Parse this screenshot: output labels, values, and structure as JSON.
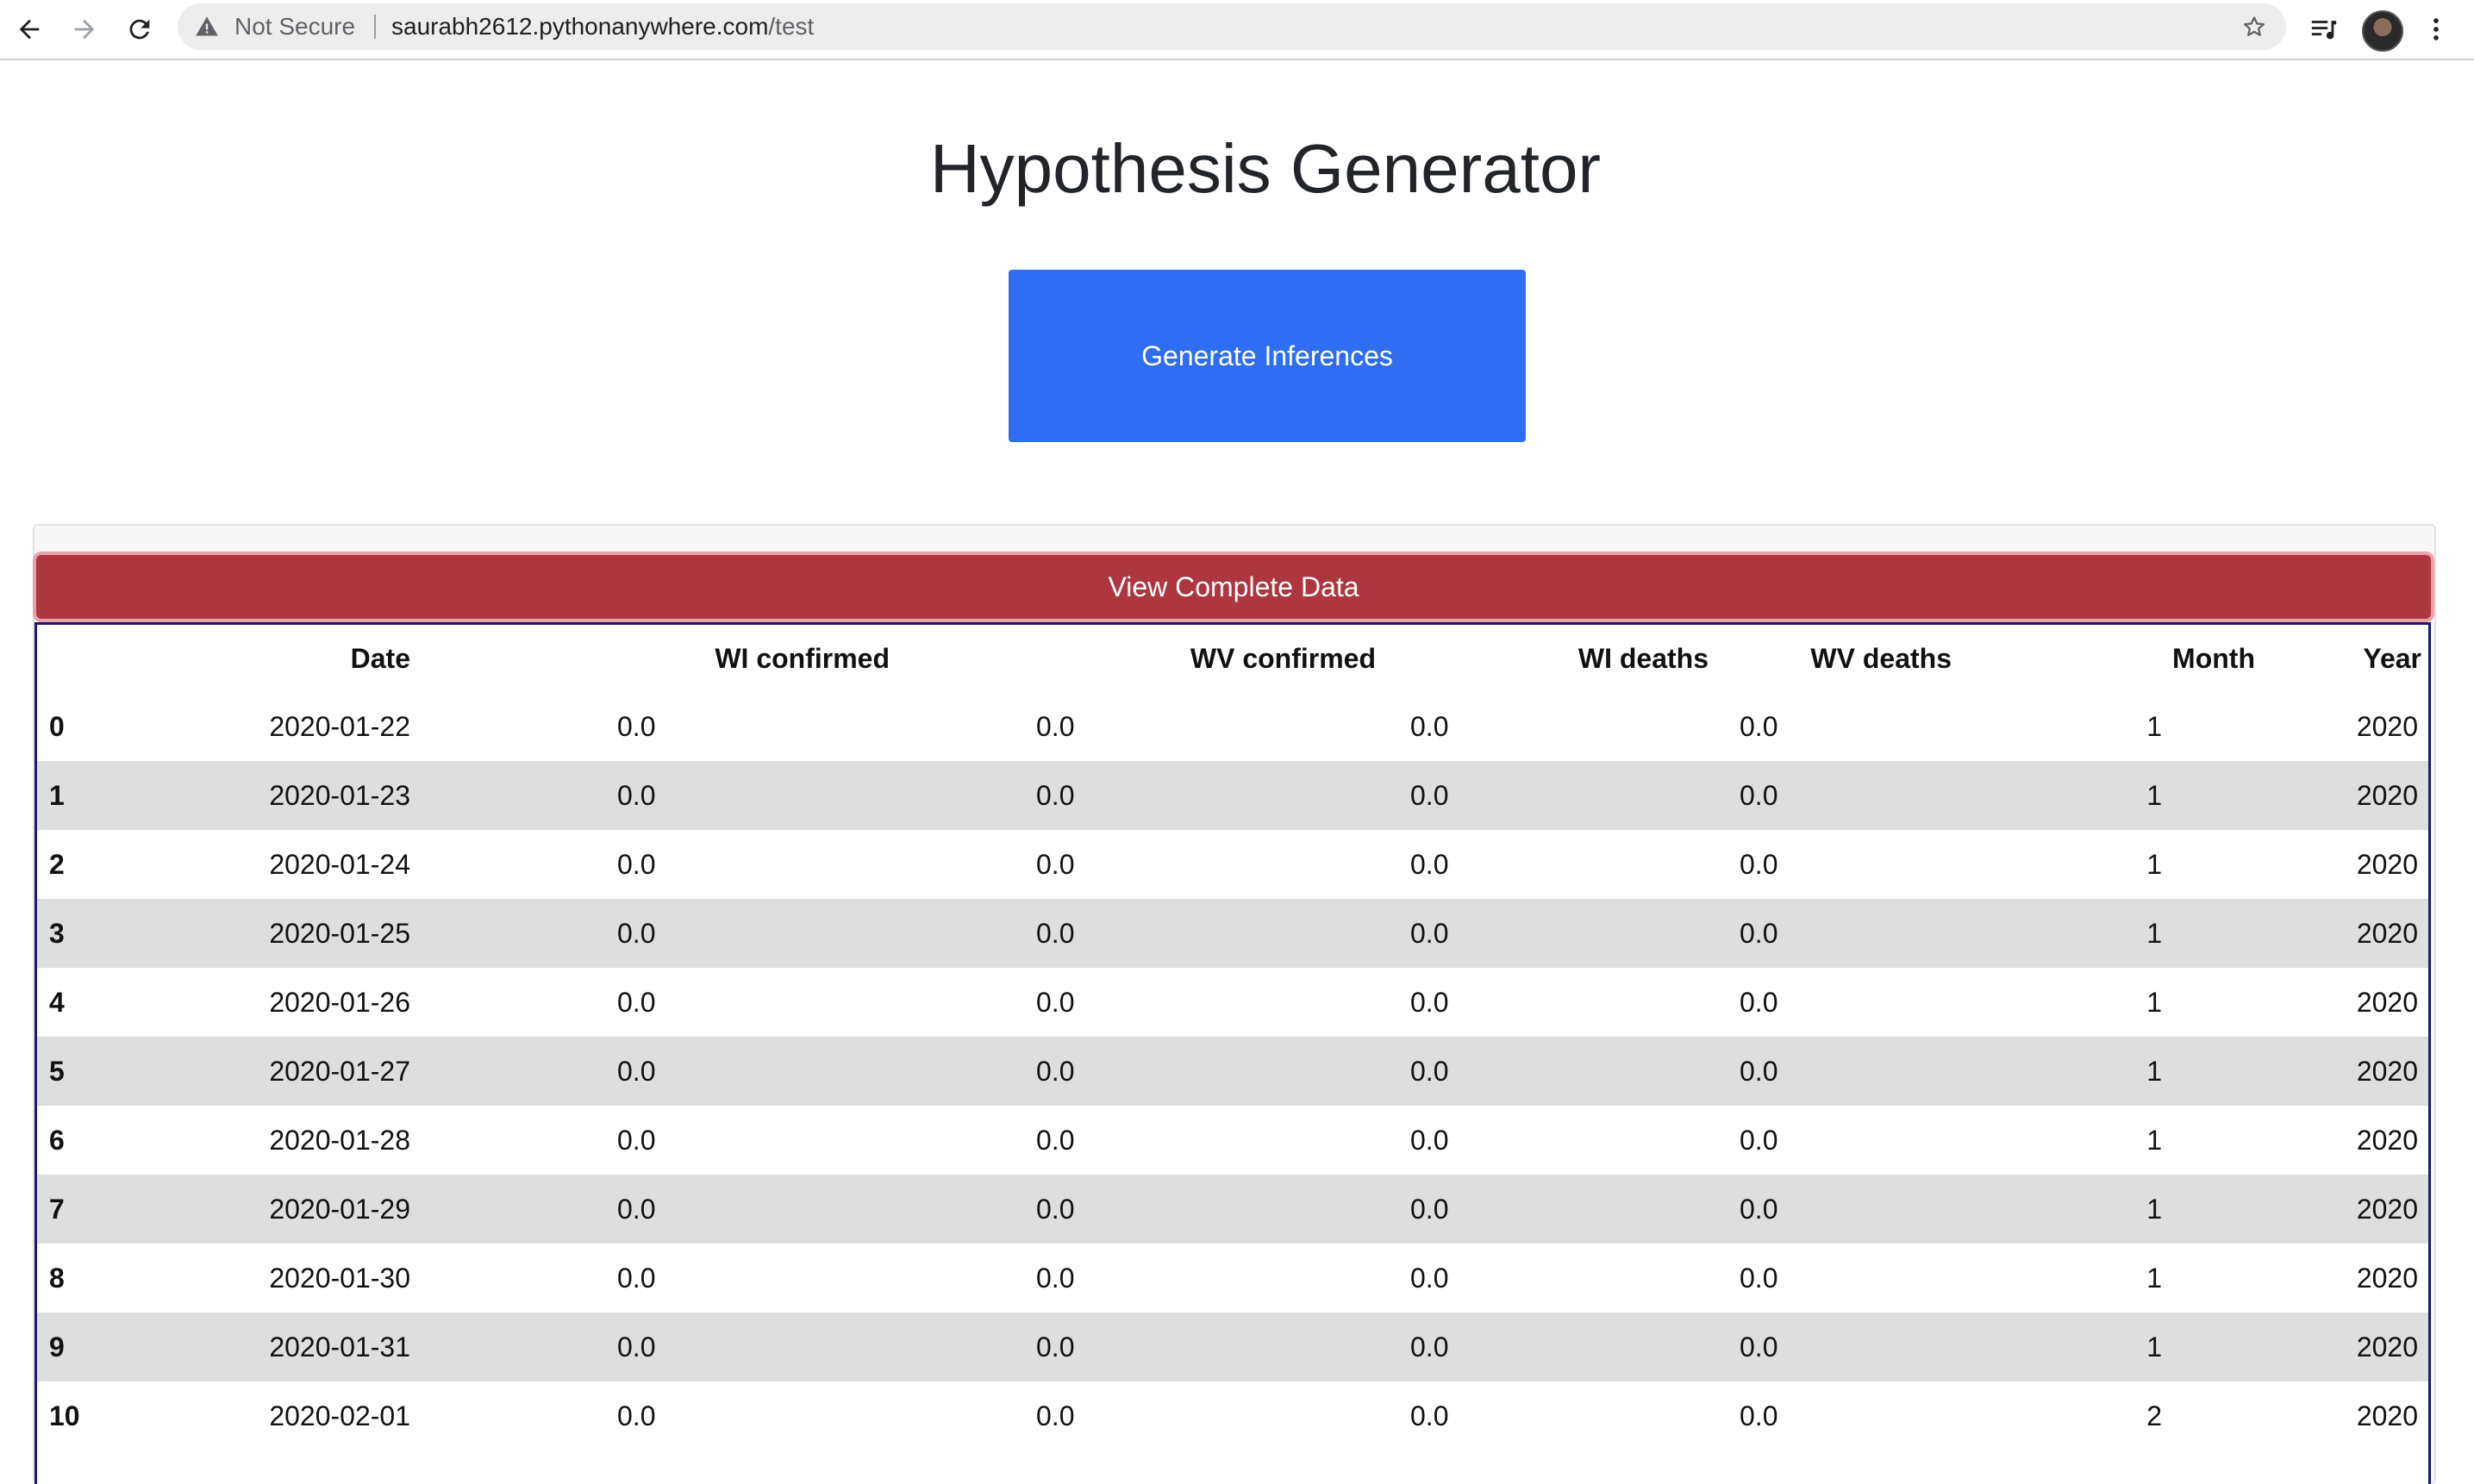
{
  "browser": {
    "security_label": "Not Secure",
    "url_host": "saurabh2612.pythonanywhere.com",
    "url_path": "/test",
    "icons": [
      "back-arrow-icon",
      "forward-arrow-icon",
      "reload-icon",
      "warning-icon",
      "star-icon",
      "reading-list-icon",
      "profile-avatar",
      "more-menu-icon"
    ]
  },
  "page": {
    "title": "Hypothesis Generator",
    "generate_button": "Generate Inferences",
    "view_button": "View Complete Data"
  },
  "colors": {
    "primary": "#2f6ef2",
    "danger": "#ad363f",
    "table_border": "#1c1a75",
    "stripe": "#dedede"
  },
  "table": {
    "columns": [
      "",
      "Date",
      "WI confirmed",
      "WV confirmed",
      "WI deaths",
      "WV deaths",
      "Month",
      "Year"
    ],
    "rows": [
      [
        "0",
        "2020-01-22",
        "0.0",
        "0.0",
        "0.0",
        "0.0",
        "1",
        "2020"
      ],
      [
        "1",
        "2020-01-23",
        "0.0",
        "0.0",
        "0.0",
        "0.0",
        "1",
        "2020"
      ],
      [
        "2",
        "2020-01-24",
        "0.0",
        "0.0",
        "0.0",
        "0.0",
        "1",
        "2020"
      ],
      [
        "3",
        "2020-01-25",
        "0.0",
        "0.0",
        "0.0",
        "0.0",
        "1",
        "2020"
      ],
      [
        "4",
        "2020-01-26",
        "0.0",
        "0.0",
        "0.0",
        "0.0",
        "1",
        "2020"
      ],
      [
        "5",
        "2020-01-27",
        "0.0",
        "0.0",
        "0.0",
        "0.0",
        "1",
        "2020"
      ],
      [
        "6",
        "2020-01-28",
        "0.0",
        "0.0",
        "0.0",
        "0.0",
        "1",
        "2020"
      ],
      [
        "7",
        "2020-01-29",
        "0.0",
        "0.0",
        "0.0",
        "0.0",
        "1",
        "2020"
      ],
      [
        "8",
        "2020-01-30",
        "0.0",
        "0.0",
        "0.0",
        "0.0",
        "1",
        "2020"
      ],
      [
        "9",
        "2020-01-31",
        "0.0",
        "0.0",
        "0.0",
        "0.0",
        "1",
        "2020"
      ],
      [
        "10",
        "2020-02-01",
        "0.0",
        "0.0",
        "0.0",
        "0.0",
        "2",
        "2020"
      ]
    ]
  }
}
